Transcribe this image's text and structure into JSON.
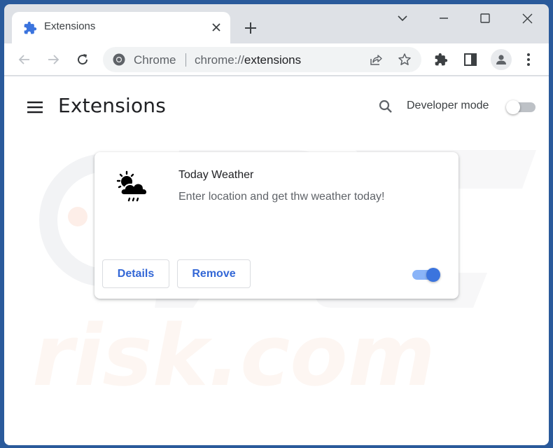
{
  "browser": {
    "tab": {
      "title": "Extensions",
      "icon": "puzzle-icon"
    },
    "new_tab_label": "+",
    "window_controls": [
      "tab-search",
      "minimize",
      "maximize",
      "close"
    ],
    "omnibox": {
      "scheme_label": "Chrome",
      "url_prefix": "chrome://",
      "url_host": "extensions"
    }
  },
  "page": {
    "title": "Extensions",
    "developer_mode": {
      "label": "Developer mode",
      "enabled": false
    }
  },
  "extensions": [
    {
      "name": "Today Weather",
      "description": "Enter location and get thw weather today!",
      "icon": "weather-sun-cloud-rain-icon",
      "enabled": true,
      "buttons": {
        "details": "Details",
        "remove": "Remove"
      }
    }
  ],
  "colors": {
    "accent": "#3367d6",
    "toggle_on_knob": "#3b74de",
    "toggle_on_track": "#8ab4f8",
    "toggle_off_track": "#bdc1c6",
    "frame": "#dee1e6",
    "desktop": "#2a5a9b"
  }
}
